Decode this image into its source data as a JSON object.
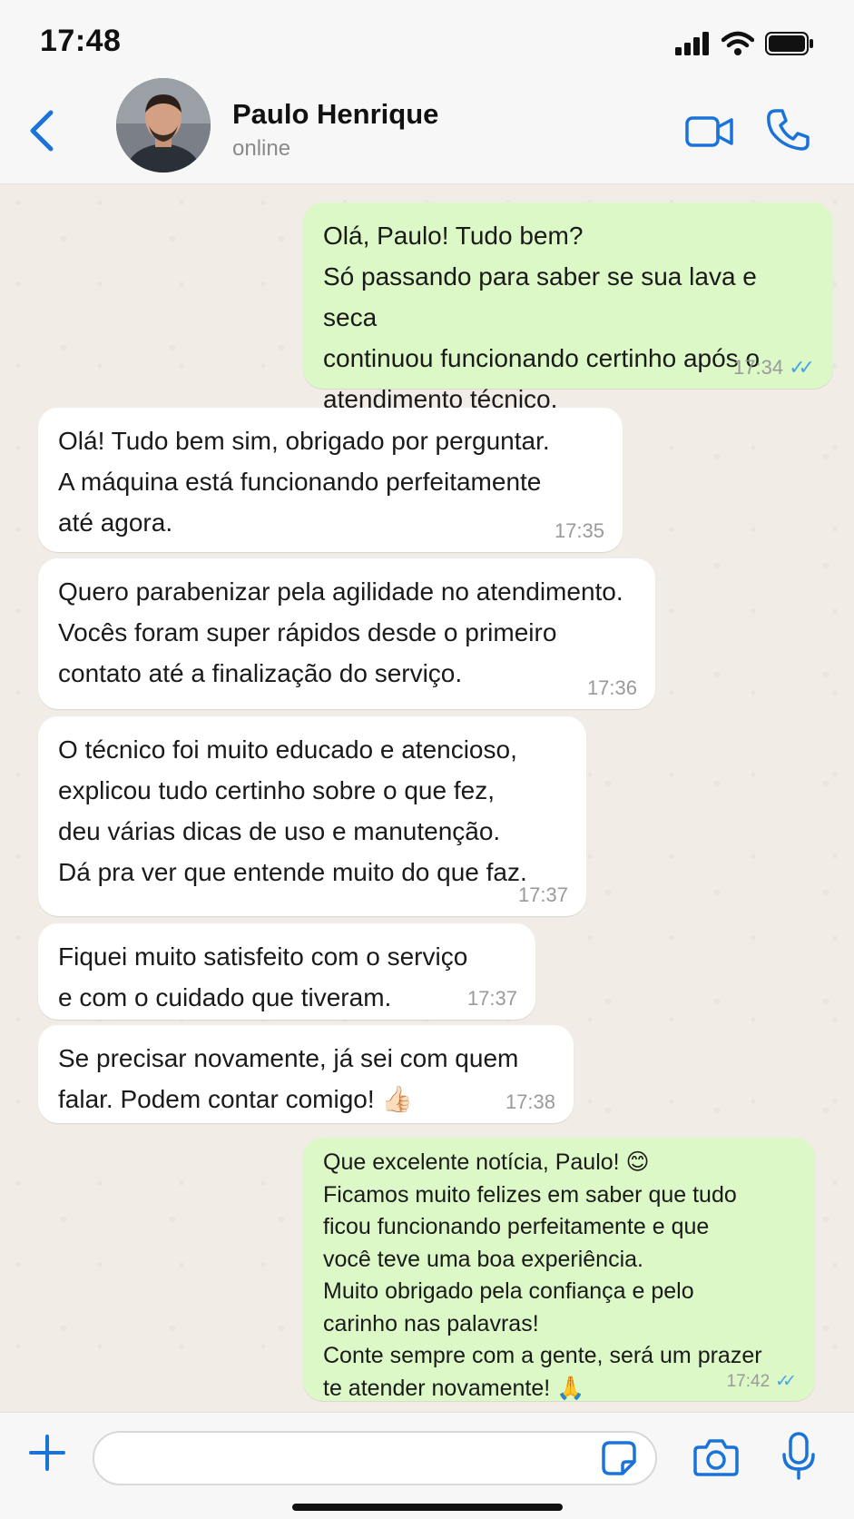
{
  "status": {
    "time": "17:48"
  },
  "header": {
    "name": "Paulo Henrique",
    "status": "online"
  },
  "messages": [
    {
      "dir": "out",
      "text": "Olá, Paulo! Tudo bem?\nSó passando para saber se sua lava e seca\ncontinuou funcionando certinho após o\natendimento técnico.",
      "time": "17:34"
    },
    {
      "dir": "in",
      "text": "Olá! Tudo bem sim, obrigado por perguntar.\nA máquina está funcionando perfeitamente\naté agora.",
      "time": "17:35"
    },
    {
      "dir": "in",
      "text": "Quero parabenizar pela agilidade no atendimento.\nVocês foram super rápidos desde o primeiro\ncontato até a finalização do serviço.",
      "time": "17:36"
    },
    {
      "dir": "in",
      "text": "O técnico foi muito educado e atencioso,\nexplicou tudo certinho sobre o que fez,\ndeu várias dicas de uso e manutenção.\nDá pra ver que entende muito do que faz.",
      "time": "17:37"
    },
    {
      "dir": "in",
      "text": "Fiquei muito satisfeito com o serviço\ne com o cuidado que tiveram.",
      "time": "17:37"
    },
    {
      "dir": "in",
      "text": "Se precisar novamente, já sei com quem\nfalar. Podem contar comigo! 👍🏻",
      "time": "17:38"
    },
    {
      "dir": "out",
      "text": "Que excelente notícia, Paulo! 😊\nFicamos muito felizes em saber que tudo\nficou funcionando perfeitamente e que\nvocê teve uma boa experiência.\nMuito obrigado pela confiança e pelo\ncarinho nas palavras!\nConte sempre com a gente, será um prazer\nte atender novamente! 🙏",
      "time": "17:42"
    }
  ],
  "input": {
    "value": "",
    "placeholder": ""
  },
  "colors": {
    "accent": "#1a73d9",
    "outgoing": "#dcf8c6",
    "incoming": "#ffffff",
    "read_ticks": "#4aa3e8"
  },
  "icons": [
    "back-icon",
    "avatar",
    "video-call-icon",
    "phone-icon",
    "plus-icon",
    "sticker-icon",
    "camera-icon",
    "microphone-icon",
    "read-ticks-icon"
  ]
}
